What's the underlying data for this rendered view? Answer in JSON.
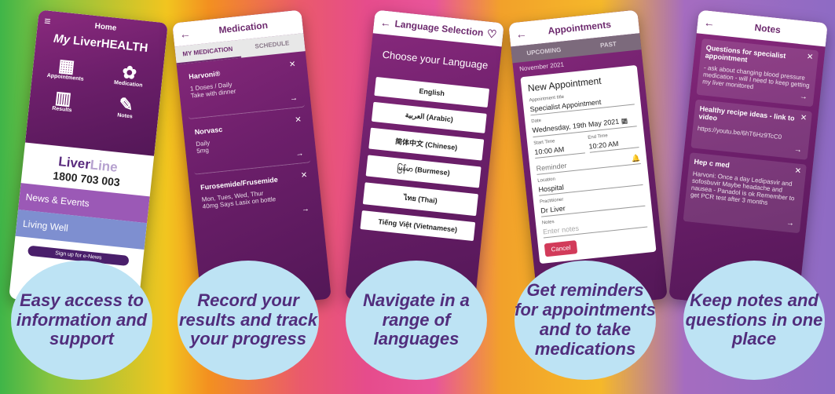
{
  "home": {
    "title": "Home",
    "brand_my": "My",
    "brand_name": "LiverHEALTH",
    "tiles": [
      "Appointments",
      "Medication",
      "Results",
      "Notes"
    ],
    "liverline_a": "Liver",
    "liverline_b": "Line",
    "phone": "1800 703 003",
    "news": "News & Events",
    "living": "Living Well",
    "signup": "Sign up for e-News"
  },
  "medication": {
    "title": "Medication",
    "tab1": "MY MEDICATION",
    "tab2": "SCHEDULE",
    "items": [
      {
        "name": "Harvoni®",
        "l1": "1 Doses / Daily",
        "l2": "Take with dinner"
      },
      {
        "name": "Norvasc",
        "l1": "Daily",
        "l2": "5mg"
      },
      {
        "name": "Furosemide/Frusemide",
        "l1": "Mon, Tues, Wed, Thur",
        "l2": "40mg Says Lasix on bottle"
      }
    ]
  },
  "language": {
    "title": "Language Selection",
    "heading": "Choose your Language",
    "options": [
      "English",
      "العربية (Arabic)",
      "简体中文 (Chinese)",
      "မြန်မာ (Burmese)",
      "ไทย (Thai)",
      "Tiếng Việt (Vietnamese)"
    ]
  },
  "appointments": {
    "title": "Appointments",
    "tab1": "UPCOMING",
    "tab2": "PAST",
    "month": "November 2021",
    "modal_title": "New Appointment",
    "l_title": "Appointment title",
    "v_title": "Specialist Appointment",
    "l_date": "Date",
    "v_date": "Wednesday, 19th May 2021",
    "l_start": "Start Time",
    "v_start": "10:00 AM",
    "l_end": "End Time",
    "v_end": "10:20 AM",
    "l_reminder": "Reminder",
    "l_location": "Location",
    "v_location": "Hospital",
    "l_practitioner": "Practitioner",
    "v_practitioner": "Dr Liver",
    "l_notes": "Notes",
    "p_notes": "Enter notes",
    "cancel": "Cancel"
  },
  "notes": {
    "title": "Notes",
    "items": [
      {
        "h": "Questions for specialist appointment",
        "b": "- ask about changing blood pressure medication - will I need to keep getting my liver monitored"
      },
      {
        "h": "Healthy recipe ideas - link to video",
        "b": "https://youtu.be/6hT6Hz9TcC0"
      },
      {
        "h": "Hep c med",
        "b": "Harvoni: Once a day Ledipasvir and sofosbuvir Maybe headache and nausea - Panadol is ok Remember to get PCR test after 3 months"
      }
    ]
  },
  "captions": [
    "Easy access to information and support",
    "Record your results and track your progress",
    "Navigate in a range of languages",
    "Get reminders for appointments and to take medications",
    "Keep notes and questions in one place"
  ]
}
